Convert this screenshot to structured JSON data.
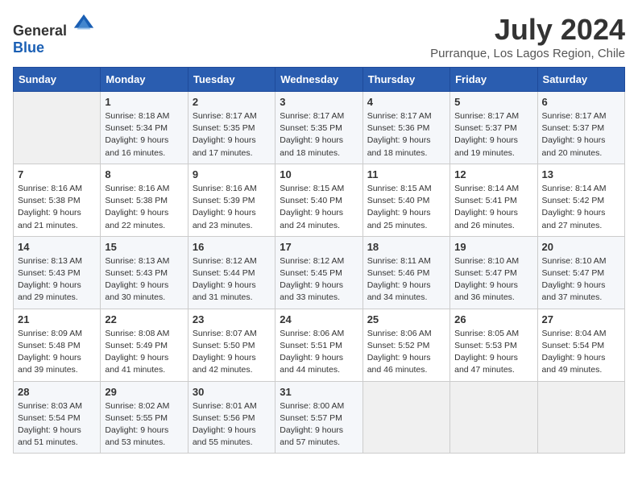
{
  "logo": {
    "general": "General",
    "blue": "Blue"
  },
  "title": "July 2024",
  "subtitle": "Purranque, Los Lagos Region, Chile",
  "days_of_week": [
    "Sunday",
    "Monday",
    "Tuesday",
    "Wednesday",
    "Thursday",
    "Friday",
    "Saturday"
  ],
  "weeks": [
    [
      {
        "day": "",
        "sunrise": "",
        "sunset": "",
        "daylight": ""
      },
      {
        "day": "1",
        "sunrise": "Sunrise: 8:18 AM",
        "sunset": "Sunset: 5:34 PM",
        "daylight": "Daylight: 9 hours and 16 minutes."
      },
      {
        "day": "2",
        "sunrise": "Sunrise: 8:17 AM",
        "sunset": "Sunset: 5:35 PM",
        "daylight": "Daylight: 9 hours and 17 minutes."
      },
      {
        "day": "3",
        "sunrise": "Sunrise: 8:17 AM",
        "sunset": "Sunset: 5:35 PM",
        "daylight": "Daylight: 9 hours and 18 minutes."
      },
      {
        "day": "4",
        "sunrise": "Sunrise: 8:17 AM",
        "sunset": "Sunset: 5:36 PM",
        "daylight": "Daylight: 9 hours and 18 minutes."
      },
      {
        "day": "5",
        "sunrise": "Sunrise: 8:17 AM",
        "sunset": "Sunset: 5:37 PM",
        "daylight": "Daylight: 9 hours and 19 minutes."
      },
      {
        "day": "6",
        "sunrise": "Sunrise: 8:17 AM",
        "sunset": "Sunset: 5:37 PM",
        "daylight": "Daylight: 9 hours and 20 minutes."
      }
    ],
    [
      {
        "day": "7",
        "sunrise": "Sunrise: 8:16 AM",
        "sunset": "Sunset: 5:38 PM",
        "daylight": "Daylight: 9 hours and 21 minutes."
      },
      {
        "day": "8",
        "sunrise": "Sunrise: 8:16 AM",
        "sunset": "Sunset: 5:38 PM",
        "daylight": "Daylight: 9 hours and 22 minutes."
      },
      {
        "day": "9",
        "sunrise": "Sunrise: 8:16 AM",
        "sunset": "Sunset: 5:39 PM",
        "daylight": "Daylight: 9 hours and 23 minutes."
      },
      {
        "day": "10",
        "sunrise": "Sunrise: 8:15 AM",
        "sunset": "Sunset: 5:40 PM",
        "daylight": "Daylight: 9 hours and 24 minutes."
      },
      {
        "day": "11",
        "sunrise": "Sunrise: 8:15 AM",
        "sunset": "Sunset: 5:40 PM",
        "daylight": "Daylight: 9 hours and 25 minutes."
      },
      {
        "day": "12",
        "sunrise": "Sunrise: 8:14 AM",
        "sunset": "Sunset: 5:41 PM",
        "daylight": "Daylight: 9 hours and 26 minutes."
      },
      {
        "day": "13",
        "sunrise": "Sunrise: 8:14 AM",
        "sunset": "Sunset: 5:42 PM",
        "daylight": "Daylight: 9 hours and 27 minutes."
      }
    ],
    [
      {
        "day": "14",
        "sunrise": "Sunrise: 8:13 AM",
        "sunset": "Sunset: 5:43 PM",
        "daylight": "Daylight: 9 hours and 29 minutes."
      },
      {
        "day": "15",
        "sunrise": "Sunrise: 8:13 AM",
        "sunset": "Sunset: 5:43 PM",
        "daylight": "Daylight: 9 hours and 30 minutes."
      },
      {
        "day": "16",
        "sunrise": "Sunrise: 8:12 AM",
        "sunset": "Sunset: 5:44 PM",
        "daylight": "Daylight: 9 hours and 31 minutes."
      },
      {
        "day": "17",
        "sunrise": "Sunrise: 8:12 AM",
        "sunset": "Sunset: 5:45 PM",
        "daylight": "Daylight: 9 hours and 33 minutes."
      },
      {
        "day": "18",
        "sunrise": "Sunrise: 8:11 AM",
        "sunset": "Sunset: 5:46 PM",
        "daylight": "Daylight: 9 hours and 34 minutes."
      },
      {
        "day": "19",
        "sunrise": "Sunrise: 8:10 AM",
        "sunset": "Sunset: 5:47 PM",
        "daylight": "Daylight: 9 hours and 36 minutes."
      },
      {
        "day": "20",
        "sunrise": "Sunrise: 8:10 AM",
        "sunset": "Sunset: 5:47 PM",
        "daylight": "Daylight: 9 hours and 37 minutes."
      }
    ],
    [
      {
        "day": "21",
        "sunrise": "Sunrise: 8:09 AM",
        "sunset": "Sunset: 5:48 PM",
        "daylight": "Daylight: 9 hours and 39 minutes."
      },
      {
        "day": "22",
        "sunrise": "Sunrise: 8:08 AM",
        "sunset": "Sunset: 5:49 PM",
        "daylight": "Daylight: 9 hours and 41 minutes."
      },
      {
        "day": "23",
        "sunrise": "Sunrise: 8:07 AM",
        "sunset": "Sunset: 5:50 PM",
        "daylight": "Daylight: 9 hours and 42 minutes."
      },
      {
        "day": "24",
        "sunrise": "Sunrise: 8:06 AM",
        "sunset": "Sunset: 5:51 PM",
        "daylight": "Daylight: 9 hours and 44 minutes."
      },
      {
        "day": "25",
        "sunrise": "Sunrise: 8:06 AM",
        "sunset": "Sunset: 5:52 PM",
        "daylight": "Daylight: 9 hours and 46 minutes."
      },
      {
        "day": "26",
        "sunrise": "Sunrise: 8:05 AM",
        "sunset": "Sunset: 5:53 PM",
        "daylight": "Daylight: 9 hours and 47 minutes."
      },
      {
        "day": "27",
        "sunrise": "Sunrise: 8:04 AM",
        "sunset": "Sunset: 5:54 PM",
        "daylight": "Daylight: 9 hours and 49 minutes."
      }
    ],
    [
      {
        "day": "28",
        "sunrise": "Sunrise: 8:03 AM",
        "sunset": "Sunset: 5:54 PM",
        "daylight": "Daylight: 9 hours and 51 minutes."
      },
      {
        "day": "29",
        "sunrise": "Sunrise: 8:02 AM",
        "sunset": "Sunset: 5:55 PM",
        "daylight": "Daylight: 9 hours and 53 minutes."
      },
      {
        "day": "30",
        "sunrise": "Sunrise: 8:01 AM",
        "sunset": "Sunset: 5:56 PM",
        "daylight": "Daylight: 9 hours and 55 minutes."
      },
      {
        "day": "31",
        "sunrise": "Sunrise: 8:00 AM",
        "sunset": "Sunset: 5:57 PM",
        "daylight": "Daylight: 9 hours and 57 minutes."
      },
      {
        "day": "",
        "sunrise": "",
        "sunset": "",
        "daylight": ""
      },
      {
        "day": "",
        "sunrise": "",
        "sunset": "",
        "daylight": ""
      },
      {
        "day": "",
        "sunrise": "",
        "sunset": "",
        "daylight": ""
      }
    ]
  ]
}
